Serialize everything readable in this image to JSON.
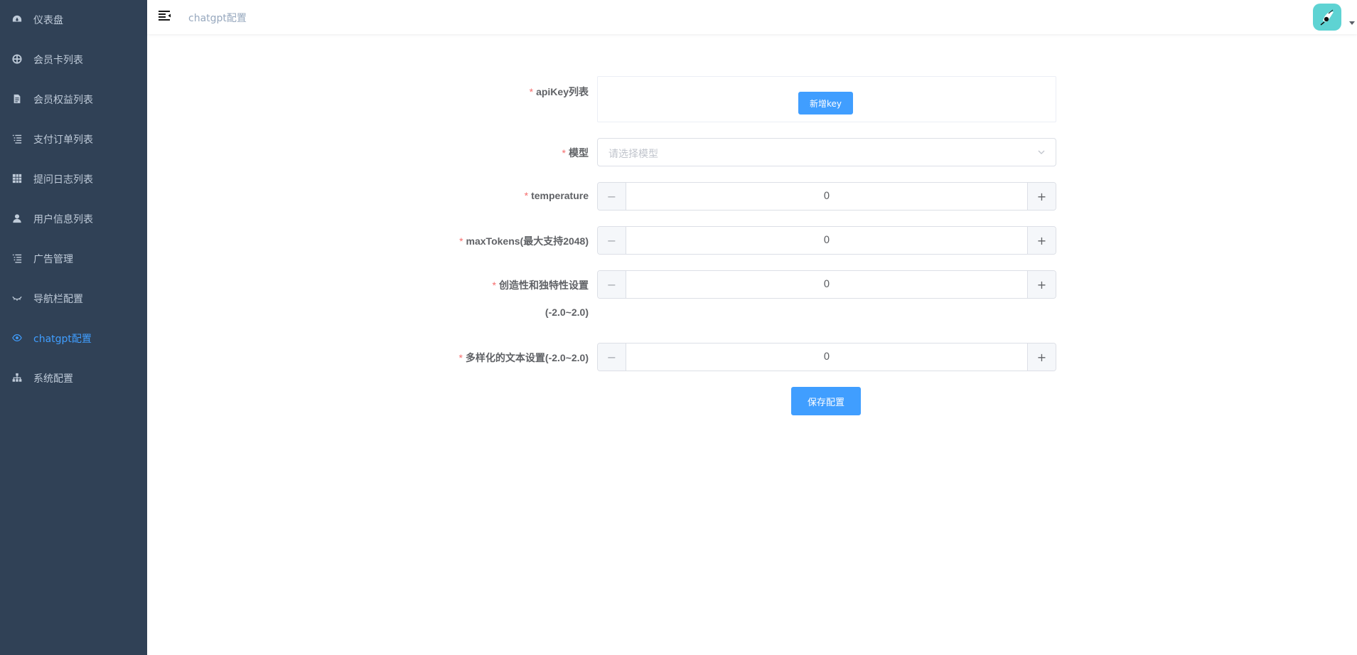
{
  "sidebar": {
    "items": [
      {
        "label": "仪表盘",
        "icon": "dashboard-icon",
        "active": false
      },
      {
        "label": "会员卡列表",
        "icon": "target-icon",
        "active": false
      },
      {
        "label": "会员权益列表",
        "icon": "document-icon",
        "active": false
      },
      {
        "label": "支付订单列表",
        "icon": "list-icon",
        "active": false
      },
      {
        "label": "提问日志列表",
        "icon": "table-icon",
        "active": false
      },
      {
        "label": "用户信息列表",
        "icon": "user-icon",
        "active": false
      },
      {
        "label": "广告管理",
        "icon": "list-icon",
        "active": false
      },
      {
        "label": "导航栏配置",
        "icon": "eye-closed-icon",
        "active": false
      },
      {
        "label": "chatgpt配置",
        "icon": "eye-icon",
        "active": true
      },
      {
        "label": "系统配置",
        "icon": "tree-icon",
        "active": false
      }
    ],
    "active_color": "#409eff"
  },
  "navbar": {
    "breadcrumb": "chatgpt配置"
  },
  "form": {
    "apikey_label": "apiKey列表",
    "add_key_label": "新增key",
    "model_label": "模型",
    "model_placeholder": "请选择模型",
    "temperature_label": "temperature",
    "temperature_value": "0",
    "max_tokens_label": "maxTokens(最大支持2048)",
    "max_tokens_value": "0",
    "presence_label_line1": "创造性和独特性设置",
    "presence_label_line2": "(-2.0~2.0)",
    "presence_value": "0",
    "frequency_label": "多样化的文本设置(-2.0~2.0)",
    "frequency_value": "0",
    "save_label": "保存配置",
    "required_mark": "*",
    "decrement": "−",
    "increment": "+"
  }
}
